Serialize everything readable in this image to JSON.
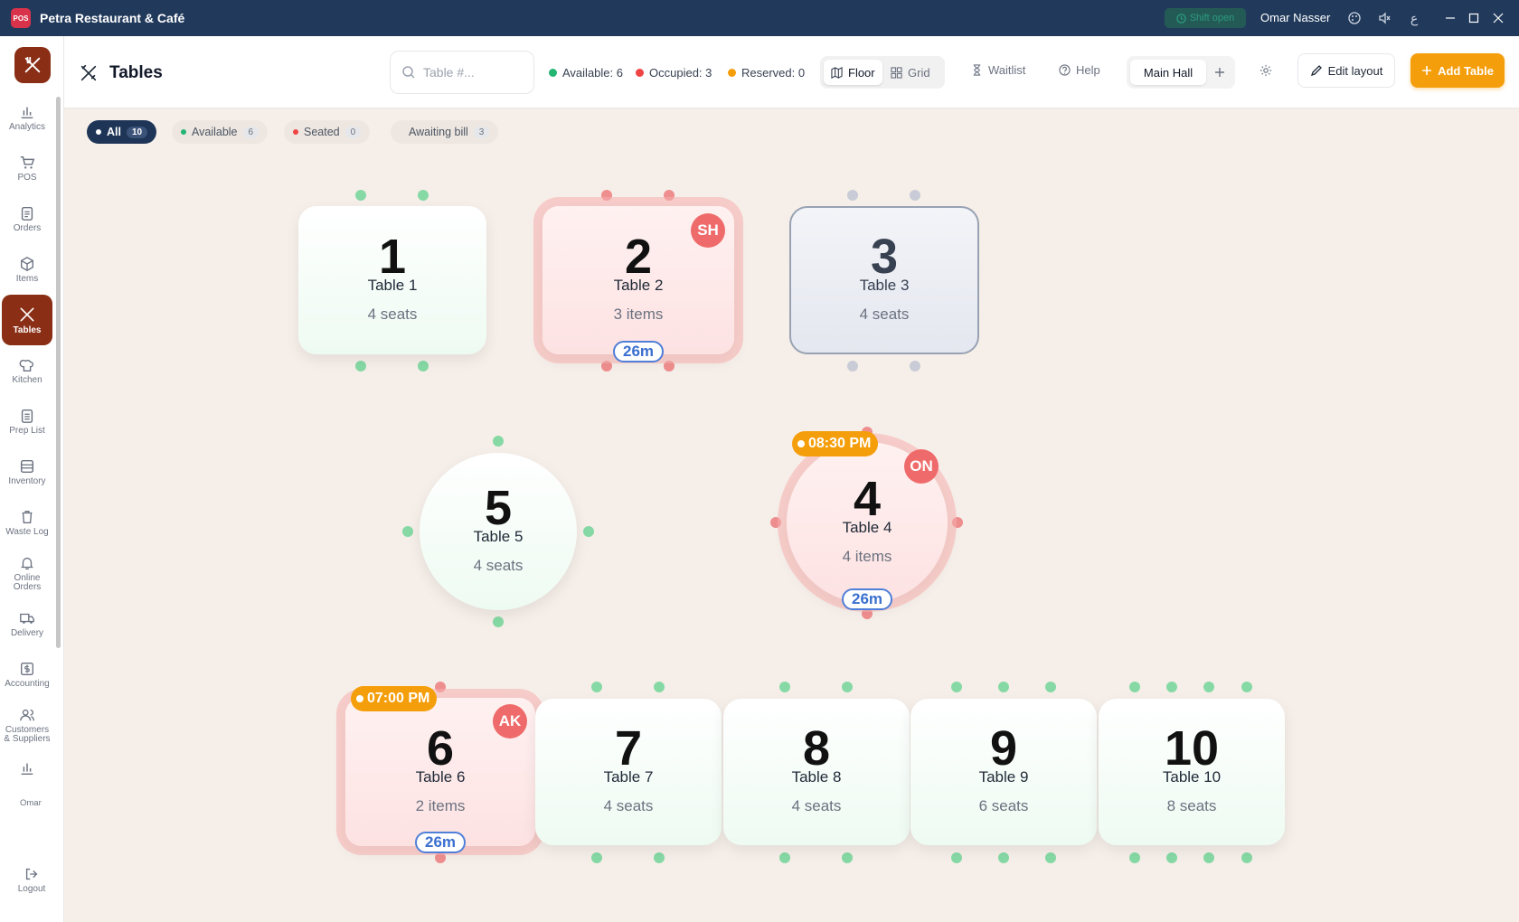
{
  "titlebar": {
    "app_title": "Petra Restaurant & Café",
    "logo_text": "POS",
    "shift_status": "Shift open",
    "user": "Omar Nasser"
  },
  "sidebar": {
    "items": [
      {
        "label": "Analytics",
        "icon": "bar-chart-icon"
      },
      {
        "label": "POS",
        "icon": "cart-icon"
      },
      {
        "label": "Orders",
        "icon": "clipboard-icon"
      },
      {
        "label": "Items",
        "icon": "box-icon"
      },
      {
        "label": "Tables",
        "icon": "utensils-icon",
        "active": true
      },
      {
        "label": "Kitchen",
        "icon": "chef-hat-icon"
      },
      {
        "label": "Prep List",
        "icon": "checklist-icon"
      },
      {
        "label": "Inventory",
        "icon": "archive-icon"
      },
      {
        "label": "Waste Log",
        "icon": "trash-icon"
      },
      {
        "label": "Online Orders",
        "icon": "bell-icon"
      },
      {
        "label": "Delivery",
        "icon": "truck-icon"
      },
      {
        "label": "Accounting",
        "icon": "dollar-icon"
      },
      {
        "label": "Customers & Suppliers",
        "icon": "users-icon"
      }
    ],
    "user_label": "Omar",
    "logout_label": "Logout"
  },
  "header": {
    "title": "Tables",
    "search_placeholder": "Table #...",
    "stats": [
      {
        "label": "Available: 6",
        "color": "#22b573"
      },
      {
        "label": "Occupied: 3",
        "color": "#ef4444"
      },
      {
        "label": "Reserved: 0",
        "color": "#f59e0b"
      }
    ],
    "view_floor": "Floor",
    "view_grid": "Grid",
    "waitlist": "Waitlist",
    "help": "Help",
    "hall": "Main Hall",
    "edit_layout": "Edit layout",
    "add_table": "Add Table"
  },
  "filters": [
    {
      "label": "All",
      "count": "10",
      "color": "#ffffff"
    },
    {
      "label": "Available",
      "count": "6",
      "color": "#22b573"
    },
    {
      "label": "Seated",
      "count": "0",
      "color": "#ef4444"
    },
    {
      "label": "Awaiting bill",
      "count": "3",
      "color": ""
    }
  ],
  "tables": [
    {
      "number": "1",
      "name": "Table 1",
      "sub": "4 seats",
      "status": "available"
    },
    {
      "number": "2",
      "name": "Table 2",
      "sub": "3 items",
      "status": "occupied",
      "badge": "SH",
      "timer": "26m"
    },
    {
      "number": "3",
      "name": "Table 3",
      "sub": "4 seats",
      "status": "reserved"
    },
    {
      "number": "4",
      "name": "Table 4",
      "sub": "4 items",
      "status": "occupied",
      "badge": "ON",
      "timer": "26m",
      "reservation": "08:30 PM"
    },
    {
      "number": "5",
      "name": "Table 5",
      "sub": "4 seats",
      "status": "available"
    },
    {
      "number": "6",
      "name": "Table 6",
      "sub": "2 items",
      "status": "occupied",
      "badge": "AK",
      "timer": "26m",
      "reservation": "07:00 PM"
    },
    {
      "number": "7",
      "name": "Table 7",
      "sub": "4 seats",
      "status": "available"
    },
    {
      "number": "8",
      "name": "Table 8",
      "sub": "4 seats",
      "status": "available"
    },
    {
      "number": "9",
      "name": "Table 9",
      "sub": "6 seats",
      "status": "available"
    },
    {
      "number": "10",
      "name": "Table 10",
      "sub": "8 seats",
      "status": "available"
    }
  ]
}
